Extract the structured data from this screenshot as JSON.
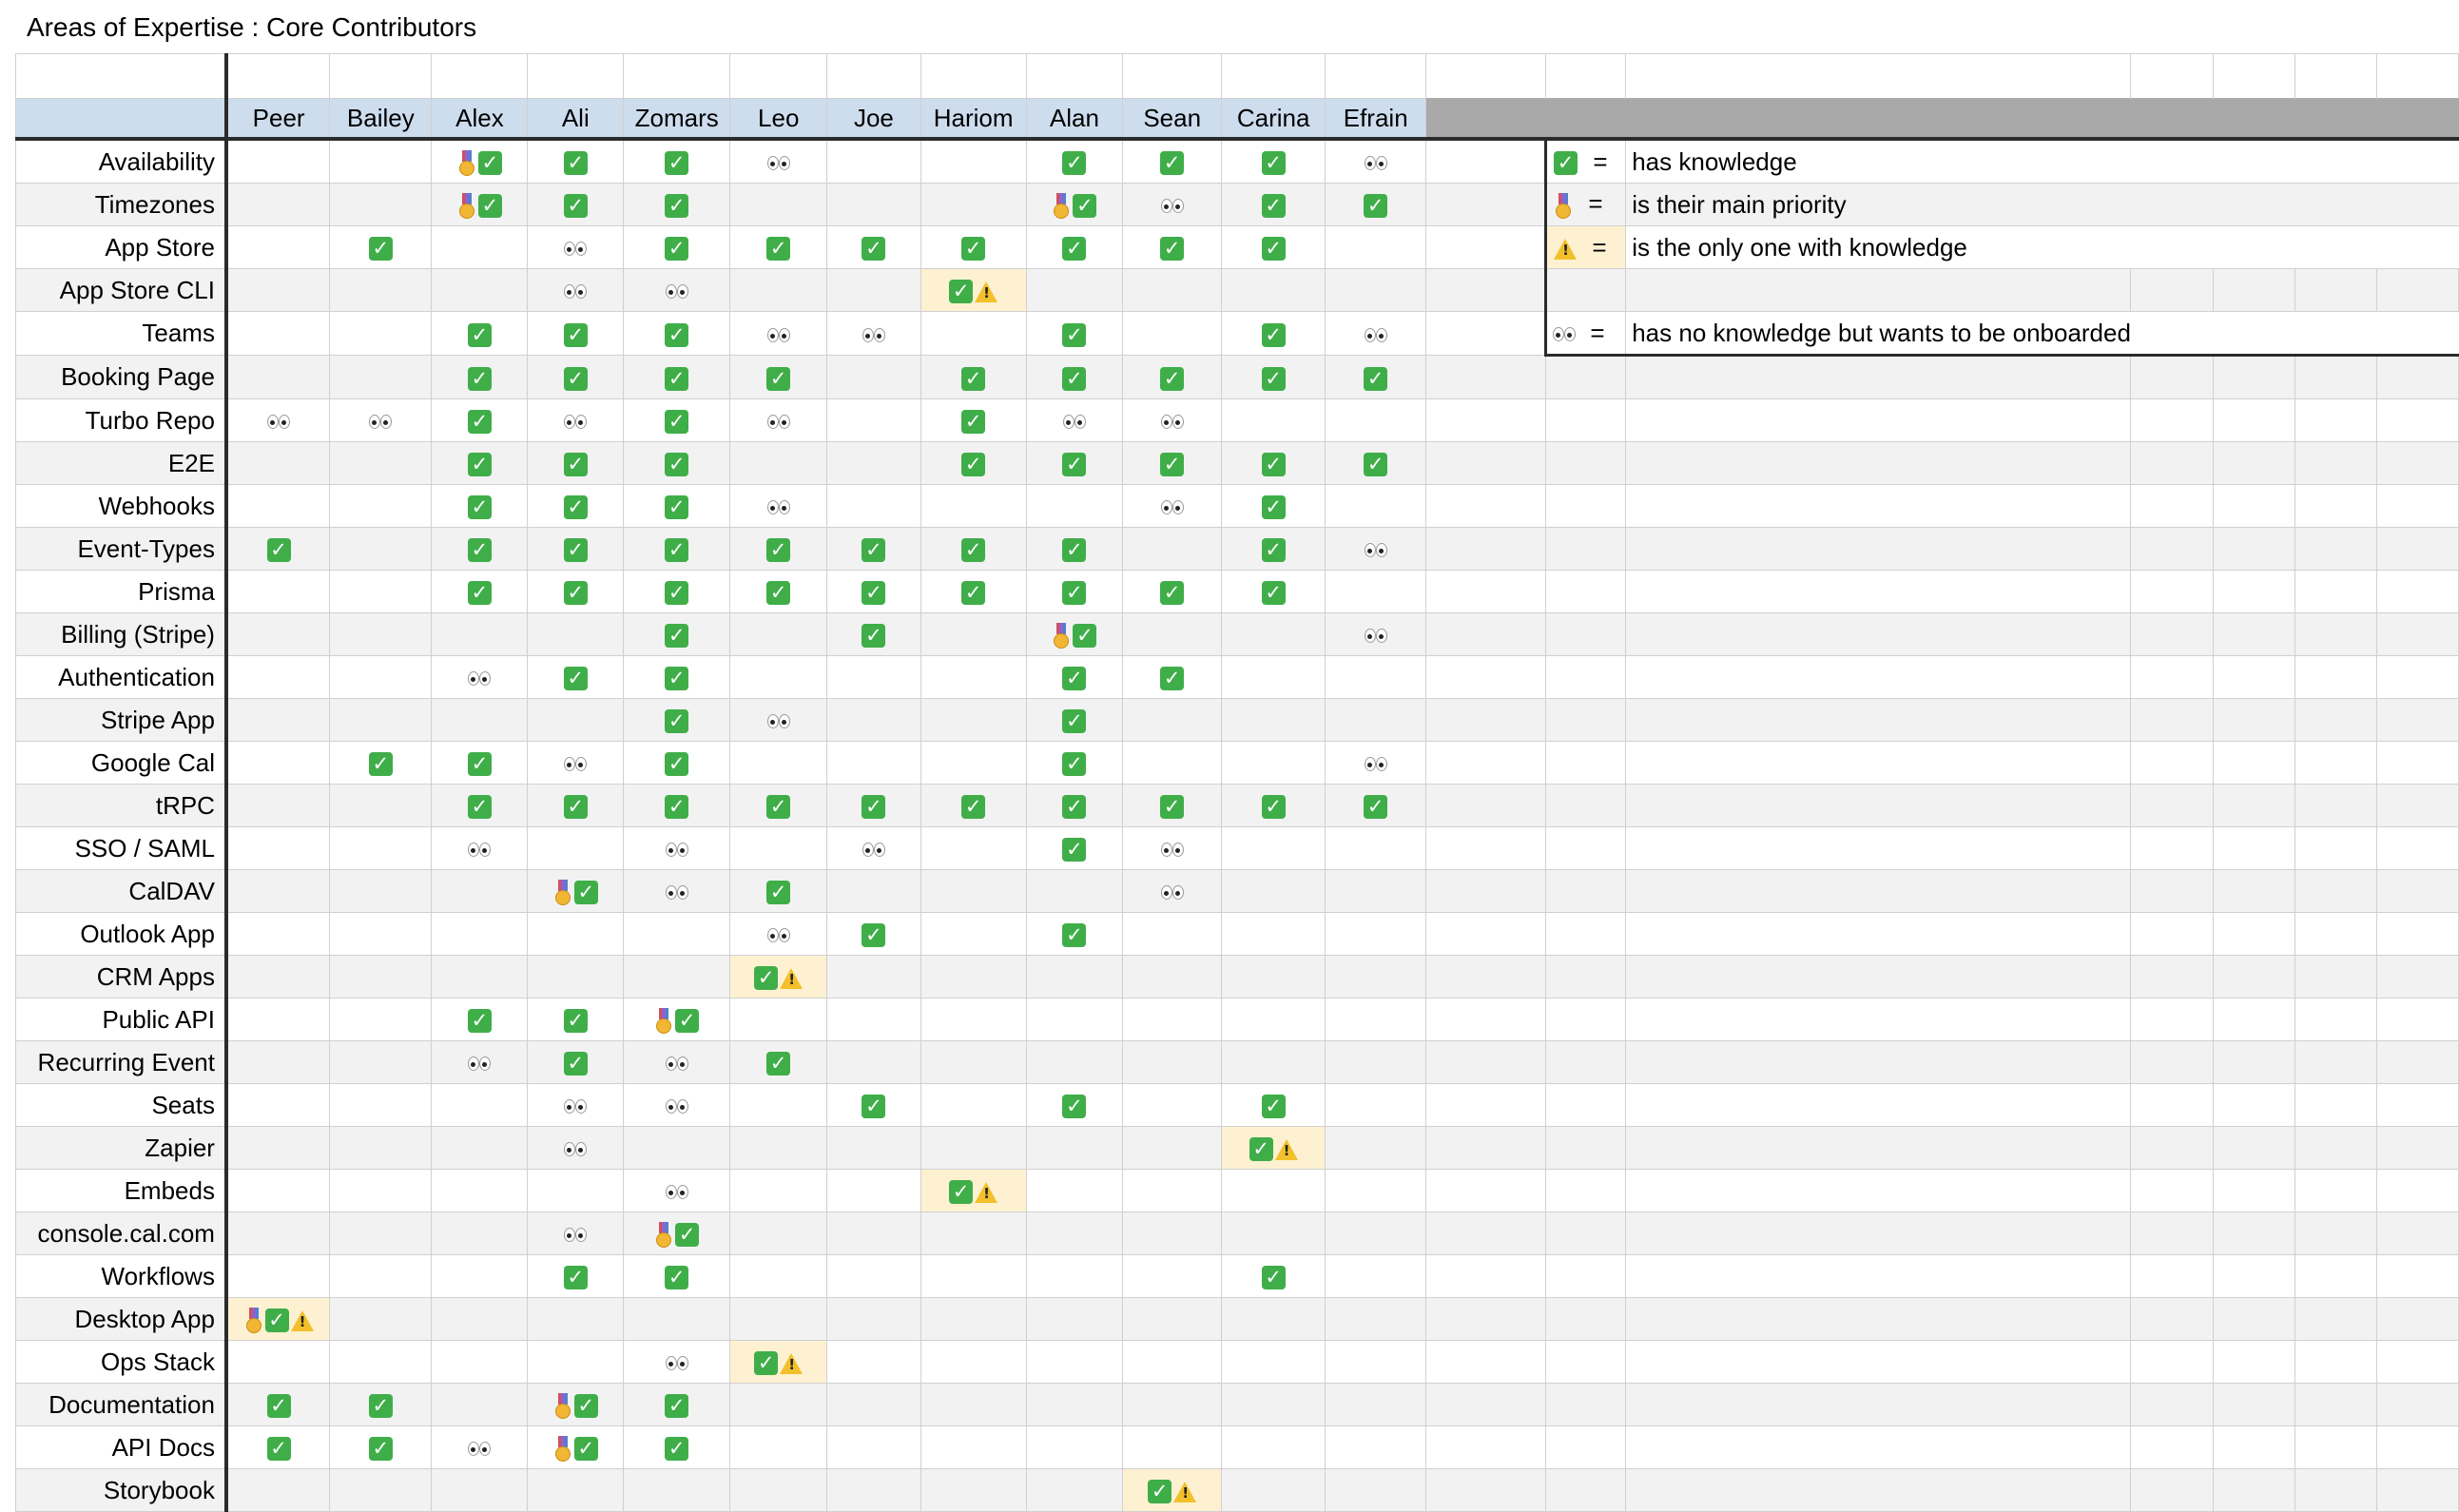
{
  "title": "Areas of Expertise : Core Contributors",
  "icons": {
    "has_knowledge": "white-heavy-check-mark-icon",
    "main_priority": "medal-icon",
    "only_one": "warning-icon",
    "wants_onboarding": "eyes-icon"
  },
  "colors": {
    "header_bg": "#cdddee",
    "alt_row_bg": "#f2f2f2",
    "highlight_bg": "#fdf1d1",
    "check_green": "#3fae49",
    "header_filler_gray": "#a9a9a9"
  },
  "people": [
    "Peer",
    "Bailey",
    "Alex",
    "Ali",
    "Zomars",
    "Leo",
    "Joe",
    "Hariom",
    "Alan",
    "Sean",
    "Carina",
    "Efrain"
  ],
  "legend": [
    {
      "symbols": "c",
      "text": "has knowledge"
    },
    {
      "symbols": "m",
      "text": "is their main priority"
    },
    {
      "symbols": "w",
      "text": "is the only one with knowledge"
    },
    {
      "symbols": "",
      "text": ""
    },
    {
      "symbols": "e",
      "text": "has no knowledge but wants to be onboarded"
    }
  ],
  "legend_equals": "=",
  "rows": [
    {
      "area": "Availability",
      "cells": [
        "",
        "",
        "mc",
        "c",
        "c",
        "e",
        "",
        "",
        "c",
        "c",
        "c",
        "e"
      ]
    },
    {
      "area": "Timezones",
      "cells": [
        "",
        "",
        "mc",
        "c",
        "c",
        "",
        "",
        "",
        "mc",
        "e",
        "c",
        "c"
      ]
    },
    {
      "area": "App Store",
      "cells": [
        "",
        "c",
        "",
        "e",
        "c",
        "c",
        "c",
        "c",
        "c",
        "c",
        "c",
        ""
      ]
    },
    {
      "area": "App Store CLI",
      "cells": [
        "",
        "",
        "",
        "e",
        "e",
        "",
        "",
        "cw",
        "",
        "",
        "",
        ""
      ]
    },
    {
      "area": "Teams",
      "cells": [
        "",
        "",
        "c",
        "c",
        "c",
        "e",
        "e",
        "",
        "c",
        "",
        "c",
        "e"
      ]
    },
    {
      "area": "Booking Page",
      "cells": [
        "",
        "",
        "c",
        "c",
        "c",
        "c",
        "",
        "c",
        "c",
        "c",
        "c",
        "c"
      ]
    },
    {
      "area": "Turbo Repo",
      "cells": [
        "e",
        "e",
        "c",
        "e",
        "c",
        "e",
        "",
        "c",
        "e",
        "e",
        "",
        ""
      ]
    },
    {
      "area": "E2E",
      "cells": [
        "",
        "",
        "c",
        "c",
        "c",
        "",
        "",
        "c",
        "c",
        "c",
        "c",
        "c"
      ]
    },
    {
      "area": "Webhooks",
      "cells": [
        "",
        "",
        "c",
        "c",
        "c",
        "e",
        "",
        "",
        "",
        "e",
        "c",
        ""
      ]
    },
    {
      "area": "Event-Types",
      "cells": [
        "c",
        "",
        "c",
        "c",
        "c",
        "c",
        "c",
        "c",
        "c",
        "",
        "c",
        "e"
      ]
    },
    {
      "area": "Prisma",
      "cells": [
        "",
        "",
        "c",
        "c",
        "c",
        "c",
        "c",
        "c",
        "c",
        "c",
        "c",
        ""
      ]
    },
    {
      "area": "Billing (Stripe)",
      "cells": [
        "",
        "",
        "",
        "",
        "c",
        "",
        "c",
        "",
        "mc",
        "",
        "",
        "e"
      ]
    },
    {
      "area": "Authentication",
      "cells": [
        "",
        "",
        "e",
        "c",
        "c",
        "",
        "",
        "",
        "c",
        "c",
        "",
        ""
      ]
    },
    {
      "area": "Stripe App",
      "cells": [
        "",
        "",
        "",
        "",
        "c",
        "e",
        "",
        "",
        "c",
        "",
        "",
        ""
      ]
    },
    {
      "area": "Google Cal",
      "cells": [
        "",
        "c",
        "c",
        "e",
        "c",
        "",
        "",
        "",
        "c",
        "",
        "",
        "e"
      ]
    },
    {
      "area": "tRPC",
      "cells": [
        "",
        "",
        "c",
        "c",
        "c",
        "c",
        "c",
        "c",
        "c",
        "c",
        "c",
        "c"
      ]
    },
    {
      "area": "SSO / SAML",
      "cells": [
        "",
        "",
        "e",
        "",
        "e",
        "",
        "e",
        "",
        "c",
        "e",
        "",
        ""
      ]
    },
    {
      "area": "CalDAV",
      "cells": [
        "",
        "",
        "",
        "mc",
        "e",
        "c",
        "",
        "",
        "",
        "e",
        "",
        ""
      ]
    },
    {
      "area": "Outlook App",
      "cells": [
        "",
        "",
        "",
        "",
        "",
        "e",
        "c",
        "",
        "c",
        "",
        "",
        ""
      ]
    },
    {
      "area": "CRM Apps",
      "cells": [
        "",
        "",
        "",
        "",
        "",
        "cw",
        "",
        "",
        "",
        "",
        "",
        ""
      ]
    },
    {
      "area": "Public API",
      "cells": [
        "",
        "",
        "c",
        "c",
        "mc",
        "",
        "",
        "",
        "",
        "",
        "",
        ""
      ]
    },
    {
      "area": "Recurring Event",
      "cells": [
        "",
        "",
        "e",
        "c",
        "e",
        "c",
        "",
        "",
        "",
        "",
        "",
        ""
      ]
    },
    {
      "area": "Seats",
      "cells": [
        "",
        "",
        "",
        "e",
        "e",
        "",
        "c",
        "",
        "c",
        "",
        "c",
        ""
      ]
    },
    {
      "area": "Zapier",
      "cells": [
        "",
        "",
        "",
        "e",
        "",
        "",
        "",
        "",
        "",
        "",
        "cw",
        ""
      ]
    },
    {
      "area": "Embeds",
      "cells": [
        "",
        "",
        "",
        "",
        "e",
        "",
        "",
        "cw",
        "",
        "",
        "",
        ""
      ]
    },
    {
      "area": "console.cal.com",
      "cells": [
        "",
        "",
        "",
        "e",
        "mc",
        "",
        "",
        "",
        "",
        "",
        "",
        ""
      ]
    },
    {
      "area": "Workflows",
      "cells": [
        "",
        "",
        "",
        "c",
        "c",
        "",
        "",
        "",
        "",
        "",
        "c",
        ""
      ]
    },
    {
      "area": "Desktop App",
      "cells": [
        "mcw",
        "",
        "",
        "",
        "",
        "",
        "",
        "",
        "",
        "",
        "",
        ""
      ]
    },
    {
      "area": "Ops Stack",
      "cells": [
        "",
        "",
        "",
        "",
        "e",
        "cw",
        "",
        "",
        "",
        "",
        "",
        ""
      ]
    },
    {
      "area": "Documentation",
      "cells": [
        "c",
        "c",
        "",
        "mc",
        "c",
        "",
        "",
        "",
        "",
        "",
        "",
        ""
      ]
    },
    {
      "area": "API Docs",
      "cells": [
        "c",
        "c",
        "e",
        "mc",
        "c",
        "",
        "",
        "",
        "",
        "",
        "",
        ""
      ]
    },
    {
      "area": "Storybook",
      "cells": [
        "",
        "",
        "",
        "",
        "",
        "",
        "",
        "",
        "",
        "cw",
        "",
        ""
      ]
    }
  ]
}
